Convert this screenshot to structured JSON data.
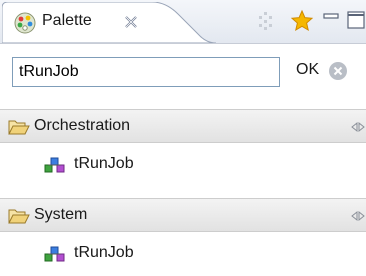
{
  "tab": {
    "title": "Palette",
    "icon": "palette-icon",
    "close_icon": "close-icon"
  },
  "toolbar": {
    "icons": [
      "customize-icon",
      "star-icon",
      "minimize-icon",
      "maximize-icon"
    ]
  },
  "search": {
    "value": "tRunJob",
    "ok_label": "OK",
    "clear_icon": "clear-icon"
  },
  "drawers": [
    {
      "label": "Orchestration",
      "icon": "folder-open-icon",
      "pin_icon": "pin-icon",
      "items": [
        {
          "label": "tRunJob",
          "icon": "component-icon"
        }
      ]
    },
    {
      "label": "System",
      "icon": "folder-open-icon",
      "pin_icon": "pin-icon",
      "items": [
        {
          "label": "tRunJob",
          "icon": "component-icon"
        }
      ]
    }
  ],
  "colors": {
    "input_border": "#7f9db9",
    "tab_border": "#9aa5b8",
    "star": "#f5b700",
    "folder": "#f0d27a"
  }
}
